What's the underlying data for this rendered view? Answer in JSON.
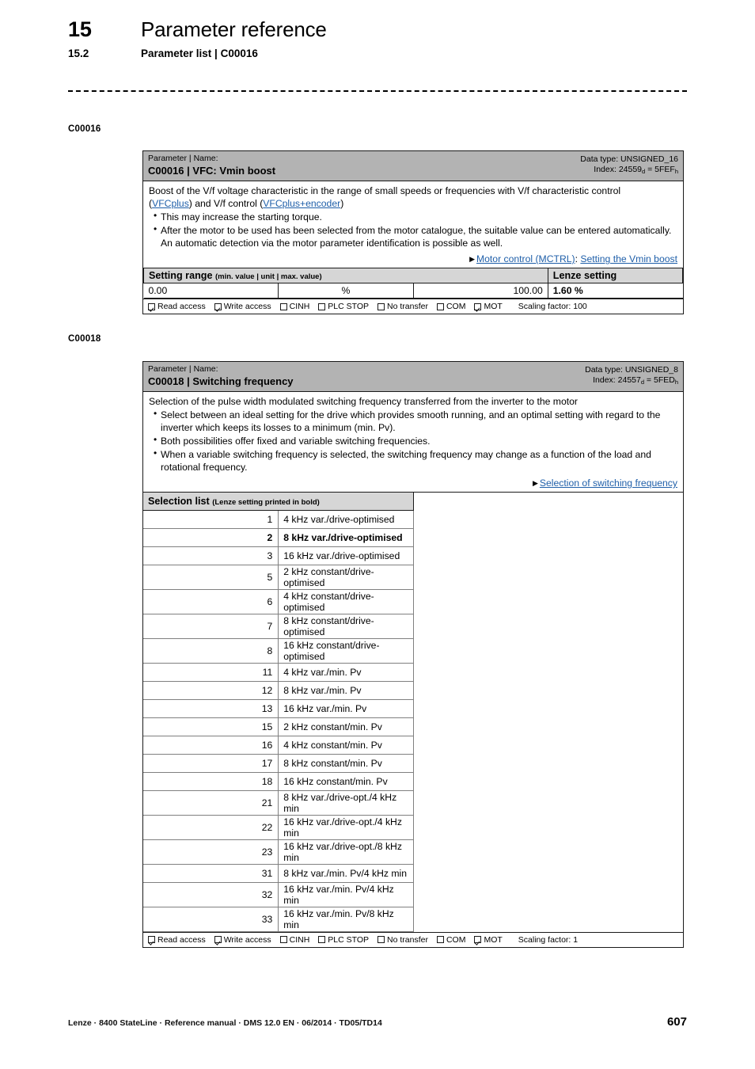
{
  "header": {
    "chapter_number": "15",
    "chapter_title": "Parameter reference",
    "section_number": "15.2",
    "section_title": "Parameter list | C00016"
  },
  "side_labels": {
    "first": "C00016",
    "second": "C00018"
  },
  "parameters": [
    {
      "side_label": "C00016",
      "head_label": "Parameter | Name:",
      "head_name": "C00016 | VFC: Vmin boost",
      "data_type": "Data type: UNSIGNED_16",
      "index_prefix": "Index: 24559",
      "index_sub_dec": "d",
      "index_mid": " = 5FEF",
      "index_sub_hex": "h",
      "desc_intro_1": "Boost of the V/f voltage characteristic in the range of small speeds or frequencies with V/f characteristic control",
      "desc_intro_2a": "(",
      "desc_link_1": "VFCplus",
      "desc_intro_2b": ") and V/f control (",
      "desc_link_2": "VFCplus+encoder",
      "desc_intro_2c": ")",
      "bullets": [
        "This may increase the starting torque.",
        "After the motor to be used has been selected from the motor catalogue, the suitable value can be entered automatically. An automatic detection via the motor parameter identification is possible as well."
      ],
      "xref_link_a": "Motor control (MCTRL)",
      "xref_sep": ": ",
      "xref_link_b": "Setting the Vmin boost",
      "setting_range": {
        "header_main": "Setting range ",
        "header_paren": "(min. value | unit | max. value)",
        "lenze_header": "Lenze setting",
        "min_value": "0.00",
        "unit": "%",
        "max_value": "100.00",
        "lenze_setting": "1.60 %"
      },
      "access": {
        "items": [
          {
            "label": "Read access",
            "checked": true
          },
          {
            "label": "Write access",
            "checked": true
          },
          {
            "label": "CINH",
            "checked": false
          },
          {
            "label": "PLC STOP",
            "checked": false
          },
          {
            "label": "No transfer",
            "checked": false
          },
          {
            "label": "COM",
            "checked": false
          },
          {
            "label": "MOT",
            "checked": true
          }
        ],
        "scaling": "Scaling factor: 100"
      }
    },
    {
      "side_label": "C00018",
      "head_label": "Parameter | Name:",
      "head_name": "C00018 | Switching frequency",
      "data_type": "Data type: UNSIGNED_8",
      "index_prefix": "Index: 24557",
      "index_sub_dec": "d",
      "index_mid": " = 5FED",
      "index_sub_hex": "h",
      "desc_intro_1": "Selection of the pulse width modulated switching frequency transferred from the inverter to the motor",
      "bullets": [
        "Select between an ideal setting for the drive which provides smooth running, and an optimal setting with regard to the inverter which keeps its losses to a minimum (min. Pv).",
        "Both possibilities offer fixed and variable switching frequencies.",
        "When a variable switching frequency is selected, the switching frequency may change as a function of the load and rotational frequency."
      ],
      "xref_link_a": "Selection of switching frequency",
      "selection_list": {
        "header_main": "Selection list ",
        "header_paren": "(Lenze setting printed in bold)",
        "rows": [
          {
            "code": "1",
            "text": "4 kHz var./drive-optimised",
            "bold": false
          },
          {
            "code": "2",
            "text": "8 kHz var./drive-optimised",
            "bold": true
          },
          {
            "code": "3",
            "text": "16 kHz var./drive-optimised",
            "bold": false
          },
          {
            "code": "5",
            "text": "2 kHz constant/drive-optimised",
            "bold": false
          },
          {
            "code": "6",
            "text": "4 kHz constant/drive-optimised",
            "bold": false
          },
          {
            "code": "7",
            "text": "8 kHz constant/drive-optimised",
            "bold": false
          },
          {
            "code": "8",
            "text": "16 kHz constant/drive-optimised",
            "bold": false
          },
          {
            "code": "11",
            "text": "4 kHz var./min. Pv",
            "bold": false
          },
          {
            "code": "12",
            "text": "8 kHz var./min. Pv",
            "bold": false
          },
          {
            "code": "13",
            "text": "16 kHz var./min. Pv",
            "bold": false
          },
          {
            "code": "15",
            "text": "2 kHz constant/min. Pv",
            "bold": false
          },
          {
            "code": "16",
            "text": "4 kHz constant/min. Pv",
            "bold": false
          },
          {
            "code": "17",
            "text": "8 kHz constant/min. Pv",
            "bold": false
          },
          {
            "code": "18",
            "text": "16 kHz constant/min. Pv",
            "bold": false
          },
          {
            "code": "21",
            "text": "8 kHz var./drive-opt./4 kHz min",
            "bold": false
          },
          {
            "code": "22",
            "text": "16 kHz var./drive-opt./4 kHz min",
            "bold": false
          },
          {
            "code": "23",
            "text": "16 kHz var./drive-opt./8 kHz min",
            "bold": false
          },
          {
            "code": "31",
            "text": "8 kHz var./min. Pv/4 kHz min",
            "bold": false
          },
          {
            "code": "32",
            "text": "16 kHz var./min. Pv/4 kHz min",
            "bold": false
          },
          {
            "code": "33",
            "text": "16 kHz var./min. Pv/8 kHz min",
            "bold": false
          }
        ]
      },
      "access": {
        "items": [
          {
            "label": "Read access",
            "checked": true
          },
          {
            "label": "Write access",
            "checked": true
          },
          {
            "label": "CINH",
            "checked": false
          },
          {
            "label": "PLC STOP",
            "checked": false
          },
          {
            "label": "No transfer",
            "checked": false
          },
          {
            "label": "COM",
            "checked": false
          },
          {
            "label": "MOT",
            "checked": true
          }
        ],
        "scaling": "Scaling factor: 1"
      }
    }
  ],
  "footer": {
    "text": "Lenze · 8400 StateLine · Reference manual · DMS 12.0 EN · 06/2014 · TD05/TD14",
    "page_number": "607"
  },
  "colors": {
    "header_gray": "#b3b3b3",
    "table_header_gray": "#d6d6d6",
    "link_blue": "#1f5fa9",
    "border": "#1a1a1a"
  }
}
